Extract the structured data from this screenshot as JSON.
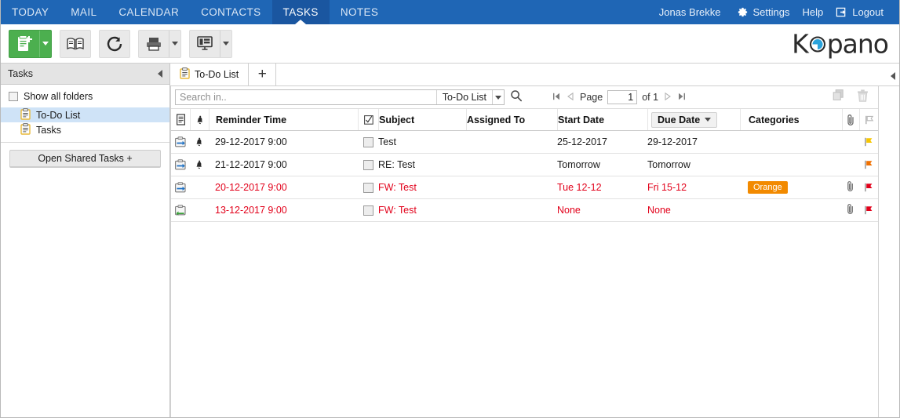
{
  "topnav": {
    "items": [
      {
        "label": "TODAY",
        "active": false
      },
      {
        "label": "MAIL",
        "active": false
      },
      {
        "label": "CALENDAR",
        "active": false
      },
      {
        "label": "CONTACTS",
        "active": false
      },
      {
        "label": "TASKS",
        "active": true
      },
      {
        "label": "NOTES",
        "active": false
      }
    ],
    "user": "Jonas Brekke",
    "settings": "Settings",
    "help": "Help",
    "logout": "Logout",
    "background": "#1f66b5",
    "active_background": "#1a56a0"
  },
  "toolbar": {
    "new_task": "new-task-button",
    "address_book": "address-book-button",
    "refresh": "refresh-button",
    "print": "print-button",
    "view": "view-button",
    "logo_text": "Kopano",
    "logo_accent": "#29a3dc"
  },
  "sidebar": {
    "title": "Tasks",
    "show_all_folders": "Show all folders",
    "folders": [
      {
        "label": "To-Do List",
        "selected": true
      },
      {
        "label": "Tasks",
        "selected": false
      }
    ],
    "shared_button": "Open Shared Tasks +"
  },
  "tabbar": {
    "tabs": [
      {
        "label": "To-Do List",
        "active": true
      }
    ],
    "add_label": "+"
  },
  "search": {
    "placeholder": "Search in..",
    "value": "",
    "scope": "To-Do List"
  },
  "pagination": {
    "page_label": "Page",
    "page_value": "1",
    "of_label": "of 1"
  },
  "grid": {
    "columns": [
      {
        "key": "icon",
        "label": "",
        "name": "column-task-icon"
      },
      {
        "key": "bell",
        "label": "",
        "name": "column-reminder-icon"
      },
      {
        "key": "reminder",
        "label": "Reminder Time",
        "name": "column-reminder-time"
      },
      {
        "key": "complete",
        "label": "",
        "name": "column-complete"
      },
      {
        "key": "subject",
        "label": "Subject",
        "name": "column-subject"
      },
      {
        "key": "assigned",
        "label": "Assigned To",
        "name": "column-assigned-to"
      },
      {
        "key": "start",
        "label": "Start Date",
        "name": "column-start-date"
      },
      {
        "key": "due",
        "label": "Due Date",
        "name": "column-due-date",
        "sorted": true,
        "sort_dir": "desc"
      },
      {
        "key": "categories",
        "label": "Categories",
        "name": "column-categories"
      },
      {
        "key": "attach",
        "label": "",
        "name": "column-attachment"
      },
      {
        "key": "flag",
        "label": "",
        "name": "column-flag"
      }
    ],
    "rows": [
      {
        "task_icon": "task-assign-icon",
        "reminder_bell": true,
        "reminder_time": "29-12-2017 9:00",
        "complete": false,
        "subject": "Test",
        "assigned_to": "",
        "start_date": "25-12-2017",
        "due_date": "29-12-2017",
        "categories": "",
        "attachment": false,
        "flag_color": "#f7c600",
        "overdue": false
      },
      {
        "task_icon": "task-assign-icon",
        "reminder_bell": true,
        "reminder_time": "21-12-2017 9:00",
        "complete": false,
        "subject": "RE: Test",
        "assigned_to": "",
        "start_date": "Tomorrow",
        "due_date": "Tomorrow",
        "categories": "",
        "attachment": false,
        "flag_color": "#f07000",
        "overdue": false
      },
      {
        "task_icon": "task-assign-icon",
        "reminder_bell": false,
        "reminder_time": "20-12-2017 9:00",
        "complete": false,
        "subject": "FW: Test",
        "assigned_to": "",
        "start_date": "Tue 12-12",
        "due_date": "Fri 15-12",
        "categories": "Orange",
        "attachment": true,
        "flag_color": "#e2001a",
        "overdue": true
      },
      {
        "task_icon": "task-accepted-icon",
        "reminder_bell": false,
        "reminder_time": "13-12-2017 9:00",
        "complete": false,
        "subject": "FW: Test",
        "assigned_to": "",
        "start_date": "None",
        "due_date": "None",
        "categories": "",
        "attachment": true,
        "flag_color": "#e2001a",
        "overdue": true
      }
    ],
    "category_badge_color": "#f28a00",
    "overdue_color": "#e2001a"
  }
}
